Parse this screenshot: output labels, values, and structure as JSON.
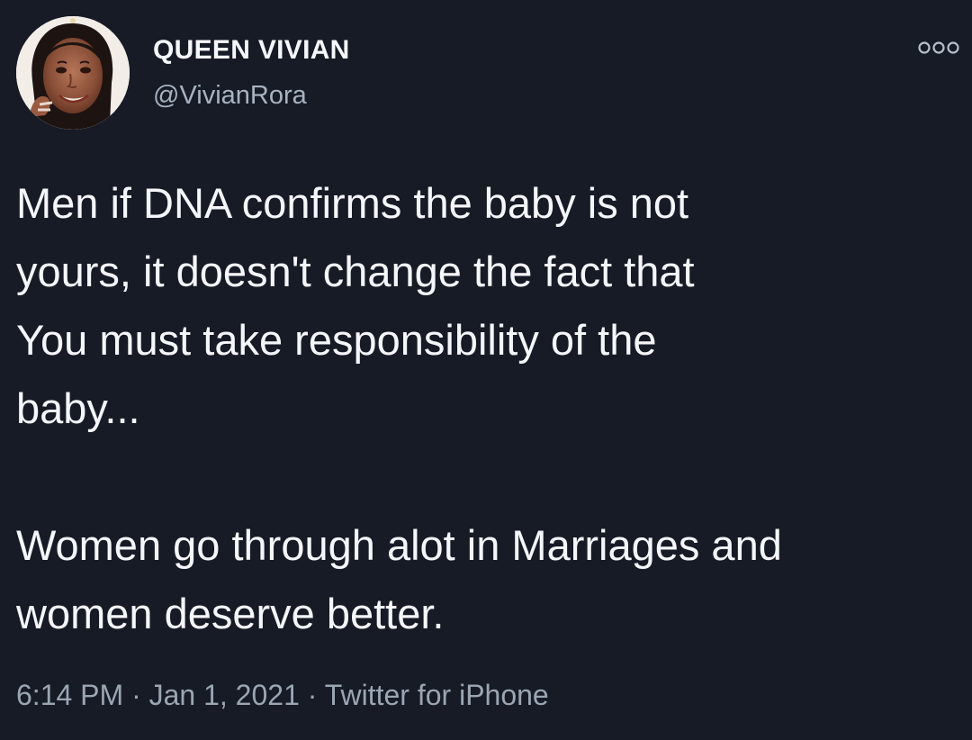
{
  "user": {
    "display_name": "QUEEN VIVIAN",
    "handle": "@VivianRora",
    "avatar_icon": "profile-photo"
  },
  "tweet": {
    "text": "Men if DNA confirms the baby is not\nyours, it doesn't change the fact that\nYou must take responsibility of the\nbaby...\n\nWomen go through alot in Marriages and\nwomen deserve better."
  },
  "meta": {
    "time": "6:14 PM",
    "separator_1": " · ",
    "date": "Jan 1, 2021",
    "separator_2": " · ",
    "source": "Twitter for iPhone"
  },
  "icons": {
    "more": "more-options-icon"
  },
  "colors": {
    "background": "#161b26",
    "text_primary": "#f4f6f9",
    "text_secondary": "#9ba6b3"
  }
}
